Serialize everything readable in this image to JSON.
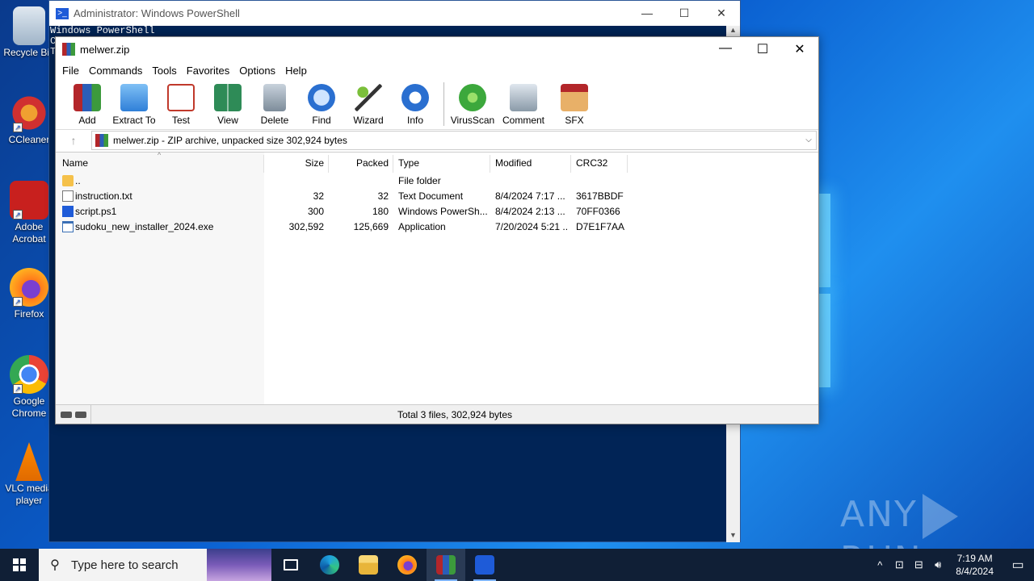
{
  "desktop": {
    "icons": [
      {
        "label": "Recycle Bin",
        "icon": "recycle-bin-icon"
      },
      {
        "label": "CCleaner",
        "icon": "ccleaner-icon"
      },
      {
        "label": "Adobe Acrobat",
        "icon": "adobe-acrobat-icon"
      },
      {
        "label": "Firefox",
        "icon": "firefox-icon"
      },
      {
        "label": "Google Chrome",
        "icon": "chrome-icon"
      },
      {
        "label": "VLC media player",
        "icon": "vlc-icon"
      }
    ],
    "watermark": "ANY RUN"
  },
  "powershell": {
    "title": "Administrator: Windows PowerShell",
    "line1": "Windows PowerShell",
    "line2": "C",
    "line3": "T"
  },
  "winrar": {
    "title": "melwer.zip",
    "menu": [
      "File",
      "Commands",
      "Tools",
      "Favorites",
      "Options",
      "Help"
    ],
    "toolbar": [
      {
        "label": "Add",
        "icon": "add-archive-icon",
        "color": "#b3262a"
      },
      {
        "label": "Extract To",
        "icon": "extract-folder-icon",
        "color": "#3f8fe0"
      },
      {
        "label": "Test",
        "icon": "test-checklist-icon",
        "color": "#c0392b"
      },
      {
        "label": "View",
        "icon": "view-book-icon",
        "color": "#2e8b57"
      },
      {
        "label": "Delete",
        "icon": "delete-trash-icon",
        "color": "#8a9aa8"
      },
      {
        "label": "Find",
        "icon": "find-magnifier-icon",
        "color": "#2a6fd0"
      },
      {
        "label": "Wizard",
        "icon": "wizard-wand-icon",
        "color": "#7bbf3a"
      },
      {
        "label": "Info",
        "icon": "info-icon",
        "color": "#2a6fd0"
      },
      {
        "label": "VirusScan",
        "icon": "virusscan-bug-icon",
        "color": "#3ca83c"
      },
      {
        "label": "Comment",
        "icon": "comment-icon",
        "color": "#8a9aa8"
      },
      {
        "label": "SFX",
        "icon": "sfx-box-icon",
        "color": "#c8862a"
      }
    ],
    "address": "melwer.zip - ZIP archive, unpacked size 302,924 bytes",
    "columns": {
      "name": "Name",
      "size": "Size",
      "packed": "Packed",
      "type": "Type",
      "modified": "Modified",
      "crc": "CRC32"
    },
    "files": [
      {
        "name": "..",
        "size": "",
        "packed": "",
        "type": "File folder",
        "modified": "",
        "crc": "",
        "icon": "folder"
      },
      {
        "name": "instruction.txt",
        "size": "32",
        "packed": "32",
        "type": "Text Document",
        "modified": "8/4/2024 7:17 ...",
        "crc": "3617BBDF",
        "icon": "txt"
      },
      {
        "name": "script.ps1",
        "size": "300",
        "packed": "180",
        "type": "Windows PowerSh...",
        "modified": "8/4/2024 2:13 ...",
        "crc": "70FF0366",
        "icon": "ps1"
      },
      {
        "name": "sudoku_new_installer_2024.exe",
        "size": "302,592",
        "packed": "125,669",
        "type": "Application",
        "modified": "7/20/2024 5:21 ...",
        "crc": "D7E1F7AA",
        "icon": "exe"
      }
    ],
    "status": "Total 3 files, 302,924 bytes"
  },
  "taskbar": {
    "search_placeholder": "Type here to search",
    "time": "7:19 AM",
    "date": "8/4/2024"
  }
}
